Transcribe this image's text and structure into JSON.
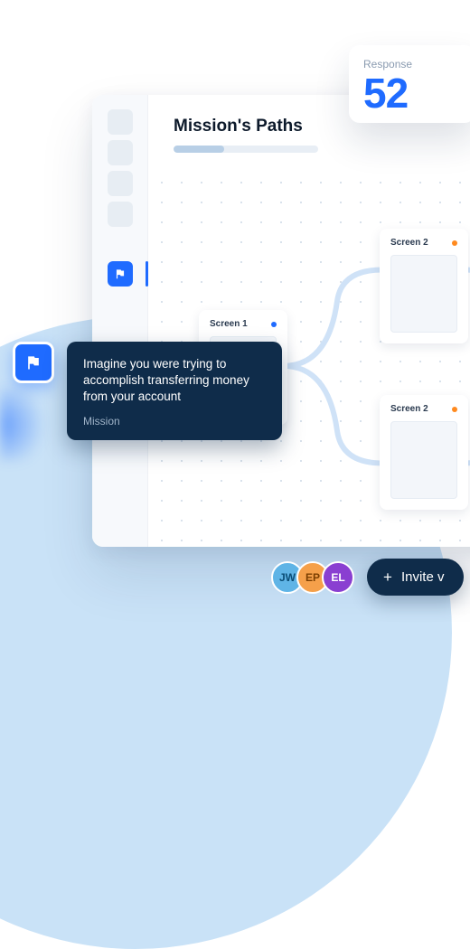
{
  "header": {
    "title": "Mission's Paths"
  },
  "nodes": {
    "screen1": {
      "label": "Screen 1"
    },
    "screen2a": {
      "label": "Screen 2"
    },
    "screen2b": {
      "label": "Screen 2"
    }
  },
  "mission": {
    "text": "Imagine you were trying to accomplish transferring money from your account",
    "label": "Mission"
  },
  "response": {
    "label": "Response",
    "value": "52"
  },
  "invite": {
    "label": "Invite v",
    "plus": "+"
  },
  "avatars": [
    {
      "initials": "JW",
      "bg": "#5fb4e6",
      "fg": "#0a4d76"
    },
    {
      "initials": "EP",
      "bg": "#f5a04a",
      "fg": "#7a3e00"
    },
    {
      "initials": "EL",
      "bg": "#8a3fd1",
      "fg": "#ffffff"
    }
  ],
  "colors": {
    "accent": "#1f6bff",
    "dark": "#0f2c4a"
  }
}
